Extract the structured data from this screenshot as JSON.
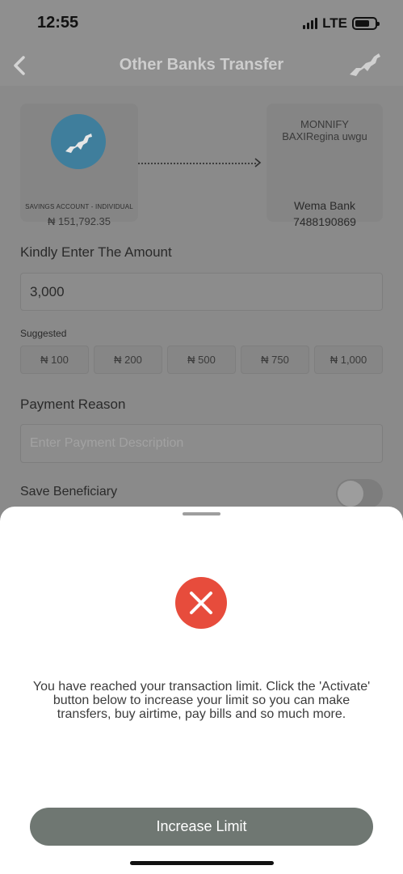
{
  "status_bar": {
    "time": "12:55",
    "network": "LTE"
  },
  "header": {
    "title": "Other Banks Transfer"
  },
  "source_account": {
    "type": "SAVINGS ACCOUNT - INDIVIDUAL",
    "balance": "₦ 151,792.35"
  },
  "beneficiary": {
    "name_line1": "MONNIFY",
    "name_line2": "BAXIRegina uwgu",
    "bank": "Wema Bank",
    "account_number": "7488190869"
  },
  "amount": {
    "label": "Kindly Enter The Amount",
    "value": "3,000"
  },
  "suggested": {
    "label": "Suggested",
    "chips": [
      "₦ 100",
      "₦ 200",
      "₦ 500",
      "₦ 750",
      "₦ 1,000"
    ]
  },
  "payment_reason": {
    "label": "Payment Reason",
    "placeholder": "Enter Payment Description"
  },
  "save_beneficiary": {
    "label": "Save Beneficiary",
    "enabled": false
  },
  "sheet": {
    "message": "You have reached your transaction limit. Click the 'Activate' button below to increase your limit so you can make transfers, buy airtime, pay bills and so much more.",
    "button_label": "Increase Limit"
  },
  "colors": {
    "error": "#e74c3c",
    "button": "#6f7772",
    "avatar": "#3f7e9c"
  }
}
